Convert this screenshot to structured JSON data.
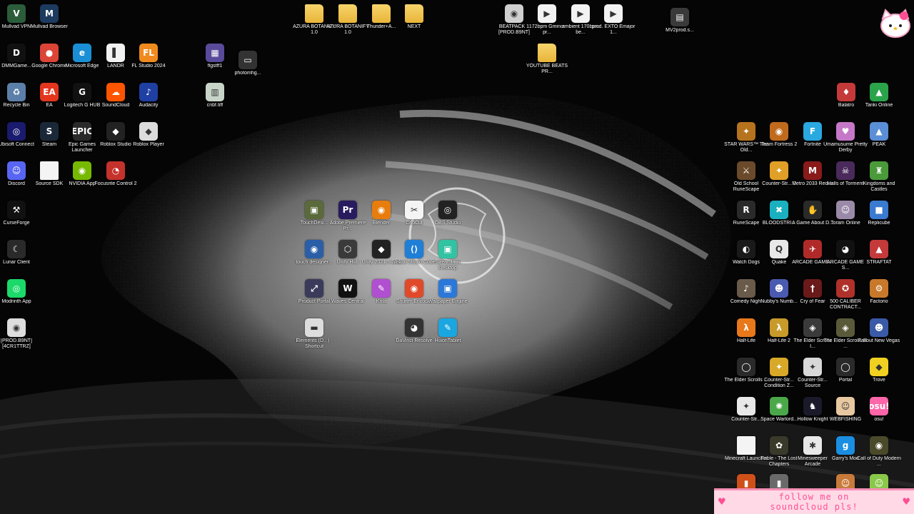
{
  "colors": {
    "background": "#000000",
    "label": "#ffffff",
    "banner_bg": "#ffd9e6",
    "banner_text": "#ff4f93"
  },
  "wallpaper": {
    "subject": "monochrome hand with dragon emblem"
  },
  "overlay": {
    "line1": "follow me on",
    "line2": "soundcloud pls!",
    "icon": "heart-icon"
  },
  "sticker": {
    "icon": "hello-kitty-icon"
  },
  "icons": [
    {
      "label": "Mullvad VPN",
      "icon": "mullvad-vpn-icon",
      "color": "#2b5d3a",
      "glyph": "V"
    },
    {
      "label": "Mullvad Browser",
      "icon": "mullvad-browser-icon",
      "color": "#1d3a5f",
      "glyph": "M"
    },
    {
      "label": "DMMGame...",
      "icon": "dmm-icon",
      "color": "#111111",
      "glyph": "D"
    },
    {
      "label": "Google Chrome",
      "icon": "chrome-icon",
      "color": "#db4437",
      "glyph": "●"
    },
    {
      "label": "Microsoft Edge",
      "icon": "edge-icon",
      "color": "#1a8fd6",
      "glyph": "e"
    },
    {
      "label": "LANDR",
      "icon": "landr-icon",
      "color": "#f2f2f2",
      "glyph": "▌"
    },
    {
      "label": "FL Studio 2024",
      "icon": "fl-studio-icon",
      "color": "#f08a1f",
      "glyph": "FL"
    },
    {
      "label": "Recycle Bin",
      "icon": "recycle-bin-icon",
      "color": "#5b7fa8",
      "glyph": "♻"
    },
    {
      "label": "EA",
      "icon": "ea-icon",
      "color": "#e4361d",
      "glyph": "EA"
    },
    {
      "label": "Logitech G HUB",
      "icon": "logitech-icon",
      "color": "#111111",
      "glyph": "G"
    },
    {
      "label": "SoundCloud",
      "icon": "soundcloud-icon",
      "color": "#ff5500",
      "glyph": "☁"
    },
    {
      "label": "Audacity",
      "icon": "audacity-icon",
      "color": "#1f3fa3",
      "glyph": "♪"
    },
    {
      "label": "Ubisoft Connect",
      "icon": "ubisoft-icon",
      "color": "#1a1a6e",
      "glyph": "◎"
    },
    {
      "label": "Steam",
      "icon": "steam-icon",
      "color": "#1b2838",
      "glyph": "S"
    },
    {
      "label": "Epic Games Launcher",
      "icon": "epic-games-icon",
      "color": "#2a2a2a",
      "glyph": "EPIC"
    },
    {
      "label": "Roblox Studio",
      "icon": "roblox-studio-icon",
      "color": "#222222",
      "glyph": "◆"
    },
    {
      "label": "Roblox Player",
      "icon": "roblox-player-icon",
      "color": "#dcdcdc",
      "glyph": "◆"
    },
    {
      "label": "Discord",
      "icon": "discord-icon",
      "color": "#5865f2",
      "glyph": "☺"
    },
    {
      "label": "Source SDK",
      "icon": "source-sdk-icon",
      "color": "#f4f4f4",
      "glyph": ""
    },
    {
      "label": "NVIDIA App",
      "icon": "nvidia-icon",
      "color": "#76b900",
      "glyph": "◉"
    },
    {
      "label": "Focusrite Control 2",
      "icon": "focusrite-icon",
      "color": "#c4322b",
      "glyph": "◔"
    },
    {
      "label": "CurseForge",
      "icon": "curseforge-icon",
      "color": "#111111",
      "glyph": "⚒"
    },
    {
      "label": "Lunar Client",
      "icon": "lunar-client-icon",
      "color": "#2a2a2a",
      "glyph": "☾"
    },
    {
      "label": "Modrinth App",
      "icon": "modrinth-icon",
      "color": "#1bd96a",
      "glyph": "◎"
    },
    {
      "label": "[PROD.B9NT] [4CR1TTRZ]",
      "icon": "audio-file-icon",
      "color": "#dddddd",
      "glyph": "◉"
    },
    {
      "label": "flgstff1",
      "icon": "image-file-icon",
      "color": "#5a4a9a",
      "glyph": "▦"
    },
    {
      "label": "photomhg...",
      "icon": "image-file-icon",
      "color": "#333333",
      "glyph": "▭"
    },
    {
      "label": "cnbf.tiff",
      "icon": "image-file-icon",
      "color": "#c8d4c8",
      "glyph": "▥"
    },
    {
      "label": "AZURA BOTANIFY 1.0",
      "icon": "folder-icon",
      "color": "#f2c44f",
      "glyph": ""
    },
    {
      "label": "AZURA BOTANIFY 1.0",
      "icon": "folder-icon",
      "color": "#f2c44f",
      "glyph": ""
    },
    {
      "label": "Thunder+A...",
      "icon": "folder-icon",
      "color": "#f2c44f",
      "glyph": ""
    },
    {
      "label": "NEXT",
      "icon": "folder-icon",
      "color": "#f2c44f",
      "glyph": ""
    },
    {
      "label": "BEATPACK 1 [PROD.B9NT]",
      "icon": "disc-icon",
      "color": "#cfcfcf",
      "glyph": "◉"
    },
    {
      "label": "172bpm Gminor pr...",
      "icon": "audio-file-icon",
      "color": "#f2f2f2",
      "glyph": "▶"
    },
    {
      "label": "ambient 170bpm be...",
      "icon": "audio-file-icon",
      "color": "#f2f2f2",
      "glyph": "▶"
    },
    {
      "label": "prod. EXTO Emajor 1...",
      "icon": "audio-file-icon",
      "color": "#f2f2f2",
      "glyph": "▶"
    },
    {
      "label": "MV2prod.s...",
      "icon": "video-file-icon",
      "color": "#3a3a3a",
      "glyph": "▤"
    },
    {
      "label": "YOUTUBE BEATS PR...",
      "icon": "folder-icon",
      "color": "#f2c44f",
      "glyph": ""
    },
    {
      "label": "TouchDesi...",
      "icon": "touchdesigner-icon",
      "color": "#5a6a3a",
      "glyph": "▣"
    },
    {
      "label": "Adobe Premiere Pr...",
      "icon": "premiere-icon",
      "color": "#2a1a5e",
      "glyph": "Pr"
    },
    {
      "label": "Blender",
      "icon": "blender-icon",
      "color": "#e87d0d",
      "glyph": "◉"
    },
    {
      "label": "CapCut",
      "icon": "capcut-icon",
      "color": "#f4f4f4",
      "glyph": "✂"
    },
    {
      "label": "OBS Studio",
      "icon": "obs-icon",
      "color": "#222222",
      "glyph": "◎"
    },
    {
      "label": "touch designer...",
      "icon": "touchdesigner-icon",
      "color": "#2a5fa8",
      "glyph": "◉"
    },
    {
      "label": "Unity Hub",
      "icon": "unity-hub-icon",
      "color": "#3a3a3a",
      "glyph": "⬡"
    },
    {
      "label": "Unity 2021.3.16f1",
      "icon": "unity-icon",
      "color": "#222222",
      "glyph": "◆"
    },
    {
      "label": "Visual Studio Code",
      "icon": "vscode-icon",
      "color": "#1f7ed6",
      "glyph": "⟨⟩"
    },
    {
      "label": "Streamlabs Desktop",
      "icon": "streamlabs-icon",
      "color": "#31c3a2",
      "glyph": "▣"
    },
    {
      "label": "Product Portal",
      "icon": "product-portal-icon",
      "color": "#3a3a5a",
      "glyph": "⤢"
    },
    {
      "label": "Waves Central",
      "icon": "waves-icon",
      "color": "#111111",
      "glyph": "W"
    },
    {
      "label": "Krita",
      "icon": "krita-icon",
      "color": "#b04fd0",
      "glyph": "✎"
    },
    {
      "label": "Shutter Encoder",
      "icon": "shutter-encoder-icon",
      "color": "#e04a2a",
      "glyph": "◉"
    },
    {
      "label": "Wallpaper Engine",
      "icon": "wallpaper-engine-icon",
      "color": "#2b78d8",
      "glyph": "▣"
    },
    {
      "label": "Elements (D...) - Shortcut",
      "icon": "drive-icon",
      "color": "#dddddd",
      "glyph": "▬"
    },
    {
      "label": "DaVinci Resolve",
      "icon": "davinci-icon",
      "color": "#333333",
      "glyph": "◕"
    },
    {
      "label": "HuionTablet",
      "icon": "huion-icon",
      "color": "#1aa6e0",
      "glyph": "✎"
    },
    {
      "label": "Balatro",
      "icon": "balatro-icon",
      "color": "#c43a3a",
      "glyph": "♦"
    },
    {
      "label": "Tanki Online",
      "icon": "tanki-icon",
      "color": "#2aa34a",
      "glyph": "▲"
    },
    {
      "label": "STAR WARS™ The Old...",
      "icon": "swtor-icon",
      "color": "#b5731e",
      "glyph": "✦"
    },
    {
      "label": "Team Fortress 2",
      "icon": "tf2-icon",
      "color": "#c06a1e",
      "glyph": "◉"
    },
    {
      "label": "Fortnite",
      "icon": "fortnite-icon",
      "color": "#2aa8e0",
      "glyph": "F"
    },
    {
      "label": "Umamusume Pretty Derby",
      "icon": "umamusume-icon",
      "color": "#c678c8",
      "glyph": "♥"
    },
    {
      "label": "PEAK",
      "icon": "peak-icon",
      "color": "#5a8ed6",
      "glyph": "▲"
    },
    {
      "label": "Old School RuneScape",
      "icon": "osrs-icon",
      "color": "#6a4a2a",
      "glyph": "⚔"
    },
    {
      "label": "Counter-Str... 2",
      "icon": "cs2-icon",
      "color": "#e0a028",
      "glyph": "✦"
    },
    {
      "label": "Metro 2033 Redux",
      "icon": "metro-icon",
      "color": "#8a1a1a",
      "glyph": "M"
    },
    {
      "label": "Halls of Torment",
      "icon": "halls-of-torment-icon",
      "color": "#4a2a5a",
      "glyph": "☠"
    },
    {
      "label": "Kingdoms and Castles",
      "icon": "kingdoms-castles-icon",
      "color": "#4a9a3a",
      "glyph": "♜"
    },
    {
      "label": "RuneScape",
      "icon": "runescape-icon",
      "color": "#2a2a2a",
      "glyph": "R"
    },
    {
      "label": "BLOODSTRI...",
      "icon": "bloodstrike-icon",
      "color": "#1ab0c0",
      "glyph": "✖"
    },
    {
      "label": "A Game About D...",
      "icon": "a-game-about-icon",
      "color": "#2a2a2a",
      "glyph": "✋"
    },
    {
      "label": "Toram Online",
      "icon": "toram-icon",
      "color": "#9a8aa8",
      "glyph": "☺"
    },
    {
      "label": "Replicube",
      "icon": "replicube-icon",
      "color": "#3a7ad0",
      "glyph": "■"
    },
    {
      "label": "Watch Dogs",
      "icon": "watch-dogs-icon",
      "color": "#1a1a1a",
      "glyph": "◐"
    },
    {
      "label": "Quake",
      "icon": "quake-icon",
      "color": "#e8e8e8",
      "glyph": "Q"
    },
    {
      "label": "ARCADE GAME...",
      "icon": "arcade-game-icon",
      "color": "#b02a2a",
      "glyph": "✈"
    },
    {
      "label": "ARCADE GAME S...",
      "icon": "pacman-icon",
      "color": "#111111",
      "glyph": "◕"
    },
    {
      "label": "STRAFTAT",
      "icon": "straftat-icon",
      "color": "#c43a3a",
      "glyph": "▲"
    },
    {
      "label": "Comedy Night",
      "icon": "comedy-night-icon",
      "color": "#6a5a4a",
      "glyph": "♪"
    },
    {
      "label": "Nubby's Numb...",
      "icon": "nubby-icon",
      "color": "#4a5ab0",
      "glyph": "☻"
    },
    {
      "label": "Cry of Fear",
      "icon": "cry-of-fear-icon",
      "color": "#6a1a1a",
      "glyph": "†"
    },
    {
      "label": "500 CALIBER CONTRACT...",
      "icon": "500-caliber-icon",
      "color": "#b0302a",
      "glyph": "✪"
    },
    {
      "label": "Factorio",
      "icon": "factorio-icon",
      "color": "#c8782a",
      "glyph": "⚙"
    },
    {
      "label": "Half-Life",
      "icon": "half-life-icon",
      "color": "#e8781a",
      "glyph": "λ"
    },
    {
      "label": "Half-Life 2",
      "icon": "half-life-2-icon",
      "color": "#c89a2a",
      "glyph": "λ"
    },
    {
      "label": "The Elder Scrolls I...",
      "icon": "elder-scrolls-icon",
      "color": "#3a3a3a",
      "glyph": "◈"
    },
    {
      "label": "The Elder Scrolls III ...",
      "icon": "morrowind-icon",
      "color": "#5a5a3a",
      "glyph": "◈"
    },
    {
      "label": "Fallout New Vegas",
      "icon": "fallout-nv-icon",
      "color": "#3a5aa8",
      "glyph": "☻"
    },
    {
      "label": "The Elder Scrolls ...",
      "icon": "elder-scrolls-icon",
      "color": "#2a2a2a",
      "glyph": "◯"
    },
    {
      "label": "Counter-Str... Condition Z...",
      "icon": "cs-cz-icon",
      "color": "#d8a828",
      "glyph": "✦"
    },
    {
      "label": "Counter-Str... Source",
      "icon": "css-icon",
      "color": "#d8d8d8",
      "glyph": "✦"
    },
    {
      "label": "Portal",
      "icon": "portal-icon",
      "color": "#2a2a2a",
      "glyph": "◯"
    },
    {
      "label": "Trove",
      "icon": "trove-icon",
      "color": "#f0d020",
      "glyph": "◆"
    },
    {
      "label": "Counter-Str...",
      "icon": "cs-icon",
      "color": "#e8e8e8",
      "glyph": "✦"
    },
    {
      "label": "Space Warlord...",
      "icon": "space-warlord-icon",
      "color": "#4aa84a",
      "glyph": "✺"
    },
    {
      "label": "Hollow Knight",
      "icon": "hollow-knight-icon",
      "color": "#1a1a2a",
      "glyph": "♞"
    },
    {
      "label": "WEBFISHING",
      "icon": "webfishing-icon",
      "color": "#e8c8a0",
      "glyph": "☺"
    },
    {
      "label": "osu!",
      "icon": "osu-icon",
      "color": "#ff66aa",
      "glyph": "osu!"
    },
    {
      "label": "Minecraft Launcher",
      "icon": "minecraft-launcher-icon",
      "color": "#f4f4f4",
      "glyph": ""
    },
    {
      "label": "Fable - The Lost Chapters",
      "icon": "fable-icon",
      "color": "#3a3a2a",
      "glyph": "✿"
    },
    {
      "label": "Minesweeper Arcade",
      "icon": "minesweeper-icon",
      "color": "#e8e8e8",
      "glyph": "✱"
    },
    {
      "label": "Garry's Mod",
      "icon": "garrys-mod-icon",
      "color": "#1a8ee0",
      "glyph": "g"
    },
    {
      "label": "Call of Duty Modern ...",
      "icon": "cod-icon",
      "color": "#4a4a2a",
      "glyph": "◉"
    },
    {
      "label": "",
      "icon": "game-icon",
      "color": "#d0501a",
      "glyph": "▮"
    },
    {
      "label": "",
      "icon": "game-icon",
      "color": "#6a6a6a",
      "glyph": "▮"
    },
    {
      "label": "",
      "icon": "game-icon",
      "color": "#c87a3a",
      "glyph": "☺"
    },
    {
      "label": "",
      "icon": "game-icon",
      "color": "#8ac84a",
      "glyph": "☺"
    }
  ]
}
